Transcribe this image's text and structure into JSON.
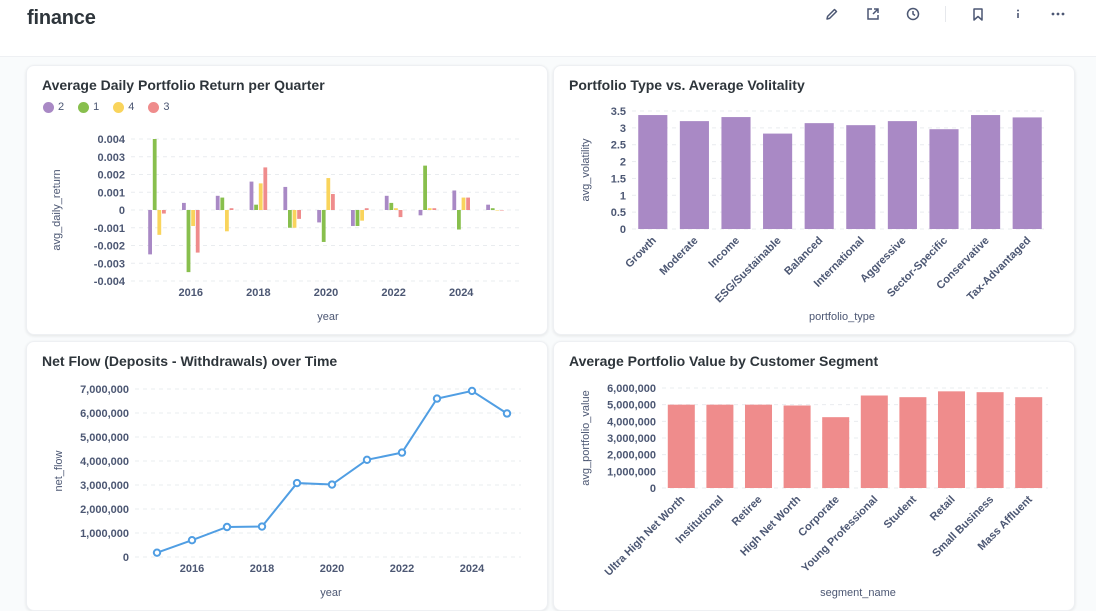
{
  "header": {
    "title": "finance",
    "icons": [
      "edit-icon",
      "share-icon",
      "history-icon",
      "bookmark-icon",
      "info-icon",
      "more-icon"
    ]
  },
  "colors": {
    "purple": "#A989C5",
    "green": "#88BF4D",
    "yellow": "#F9D45C",
    "red": "#EF8C8C",
    "blue": "#509EE3"
  },
  "cards": {
    "returns": {
      "title": "Average Daily Portfolio Return per Quarter"
    },
    "volatility": {
      "title": "Portfolio Type vs. Average Volitality"
    },
    "netflow": {
      "title": "Net Flow (Deposits - Withdrawals) over Time"
    },
    "segment": {
      "title": "Average Portfolio Value by Customer Segment"
    }
  },
  "chart_data": [
    {
      "type": "bar",
      "title": "Average Daily Portfolio Return per Quarter",
      "xlabel": "year",
      "ylabel": "avg_daily_return",
      "legend": [
        "2",
        "1",
        "4",
        "3"
      ],
      "legend_placement": "top-left",
      "ylim": [
        -0.004,
        0.004
      ],
      "yticks": [
        "0.004",
        "0.003",
        "0.002",
        "0.001",
        "0",
        "-0.001",
        "-0.002",
        "-0.003",
        "-0.004"
      ],
      "xticks": [
        "2016",
        "2018",
        "2020",
        "2022",
        "2024"
      ],
      "categories": [
        "2015",
        "2016",
        "2017",
        "2018",
        "2019",
        "2020",
        "2021",
        "2022",
        "2023",
        "2024",
        "2025"
      ],
      "series": [
        {
          "name": "2",
          "values": [
            -0.0025,
            0.0004,
            0.0008,
            0.0016,
            0.0013,
            -0.0007,
            -0.0009,
            0.0008,
            -0.0003,
            0.0011,
            0.0003
          ]
        },
        {
          "name": "1",
          "values": [
            0.004,
            -0.0035,
            0.0007,
            0.0003,
            -0.001,
            -0.0018,
            -0.0009,
            0.0004,
            0.0025,
            -0.0011,
            0.0001
          ]
        },
        {
          "name": "4",
          "values": [
            -0.0014,
            -0.0009,
            -0.0012,
            0.0015,
            -0.001,
            0.0018,
            -0.0006,
            0.0001,
            0.0001,
            0.0007,
            0
          ]
        },
        {
          "name": "3",
          "values": [
            -0.0002,
            -0.0024,
            0.0001,
            0.0024,
            -0.0005,
            0.0009,
            0.0001,
            -0.0004,
            0.0001,
            0.0007,
            0
          ]
        }
      ],
      "grid": true
    },
    {
      "type": "bar",
      "title": "Portfolio Type vs. Average Volitality",
      "xlabel": "portfolio_type",
      "ylabel": "avg_volatility",
      "ylim": [
        0,
        3.5
      ],
      "yticks": [
        "3.5",
        "3",
        "2.5",
        "2",
        "1.5",
        "1",
        "0.5",
        "0"
      ],
      "categories": [
        "Growth",
        "Moderate",
        "Income",
        "ESG/Sustainable",
        "Balanced",
        "International",
        "Aggressive",
        "Sector-Specific",
        "Conservative",
        "Tax-Advantaged"
      ],
      "values": [
        3.38,
        3.2,
        3.32,
        2.83,
        3.14,
        3.08,
        3.2,
        2.96,
        3.38,
        3.31
      ],
      "grid": true
    },
    {
      "type": "line",
      "title": "Net Flow (Deposits - Withdrawals) over Time",
      "xlabel": "year",
      "ylabel": "net_flow",
      "ylim": [
        0,
        7000000
      ],
      "yticks": [
        "7,000,000",
        "6,000,000",
        "5,000,000",
        "4,000,000",
        "3,000,000",
        "2,000,000",
        "1,000,000",
        "0"
      ],
      "xticks": [
        "2016",
        "2018",
        "2020",
        "2022",
        "2024"
      ],
      "x": [
        2015,
        2016,
        2017,
        2018,
        2019,
        2020,
        2021,
        2022,
        2023,
        2024,
        2025
      ],
      "values": [
        180000,
        700000,
        1250000,
        1270000,
        3080000,
        3020000,
        4050000,
        4350000,
        6600000,
        6920000,
        5980000
      ],
      "grid": true
    },
    {
      "type": "bar",
      "title": "Average Portfolio Value by Customer Segment",
      "xlabel": "segment_name",
      "ylabel": "avg_portfolio_value",
      "ylim": [
        0,
        6000000
      ],
      "yticks": [
        "6,000,000",
        "5,000,000",
        "4,000,000",
        "3,000,000",
        "2,000,000",
        "1,000,000",
        "0"
      ],
      "categories": [
        "Ultra High Net Worth",
        "Institutional",
        "Retiree",
        "High Net Worth",
        "Corporate",
        "Young Professional",
        "Student",
        "Retail",
        "Small Business",
        "Mass Affluent"
      ],
      "values": [
        5000000,
        5000000,
        5000000,
        4950000,
        4250000,
        5550000,
        5450000,
        5800000,
        5750000,
        5450000
      ],
      "grid": true
    }
  ]
}
